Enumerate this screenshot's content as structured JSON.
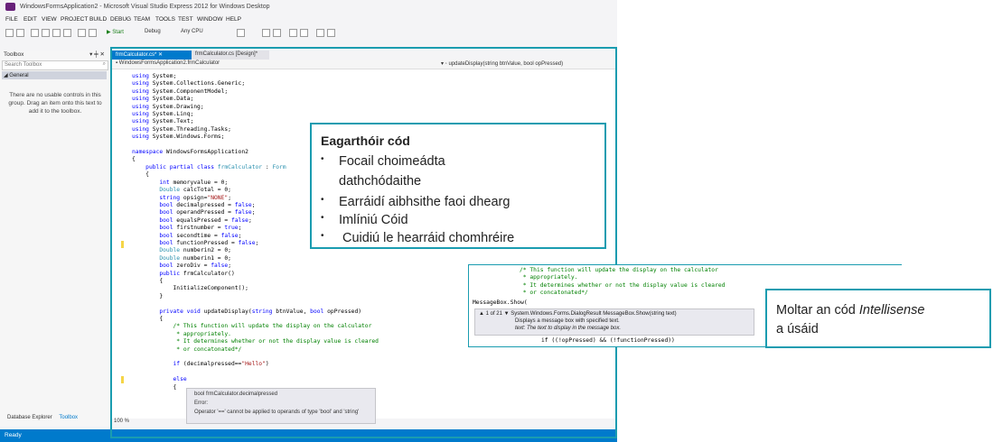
{
  "window": {
    "title": "WindowsFormsApplication2 - Microsoft Visual Studio Express 2012 for Windows Desktop"
  },
  "menu": [
    "FILE",
    "EDIT",
    "VIEW",
    "PROJECT",
    "BUILD",
    "DEBUG",
    "TEAM",
    "TOOLS",
    "TEST",
    "WINDOW",
    "HELP"
  ],
  "toolbar": {
    "start_label": "▶ Start",
    "config": "Debug",
    "platform": "Any CPU"
  },
  "toolbox": {
    "title": "Toolbox",
    "search_placeholder": "Search Toolbox",
    "group": "General",
    "empty_message": "There are no usable controls in this group. Drag an item onto this text to add it to the toolbox.",
    "bottom_tab_1": "Database Explorer",
    "bottom_tab_2": "Toolbox"
  },
  "tabs": {
    "active": "frmCalculator.cs*",
    "inactive": "frmCalculator.cs [Design]*"
  },
  "navbar": {
    "left": "WindowsFormsApplication2.frmCalculator",
    "right": "updateDisplay(string btnValue, bool opPressed)"
  },
  "editor": {
    "error_tip_line1": "bool frmCalculator.decimalpressed",
    "error_tip_line2": "Error:",
    "error_tip_line3": "Operator '==' cannot be applied to operands of type 'bool' and 'string'",
    "zoom": "100 %"
  },
  "statusbar": {
    "text": "Ready"
  },
  "callout_editor": {
    "title": "Eagarthóir cód",
    "bullets": [
      "Focail choimeádta",
      "dathchódaithe",
      "Earráidí aibhsithe faoi dhearg",
      "Imlíniú Cóid",
      "Cuidiú le hearráid chomhréire"
    ]
  },
  "intellisense": {
    "comment": "/* This function will update the display on the calculator\n * appropriately.\n * It determines whether or not the display value is cleared\n * or concatonated*/",
    "code_line": "MessageBox.Show(",
    "overload": "▲ 1 of 21 ▼  System.Windows.Forms.DialogResult MessageBox.Show(string text)",
    "desc": "Displays a message box with specified text.",
    "param": "text: The text to display in the message box.",
    "last_line": "if ((!opPressed) && (!functionPressed))"
  },
  "callout_intellisense": {
    "text_before": "Moltar an cód ",
    "text_italic": "Intellisense",
    "text_after": "a úsáid"
  },
  "colors": {
    "accent": "#1a9cb0",
    "vs_blue": "#007acc"
  }
}
